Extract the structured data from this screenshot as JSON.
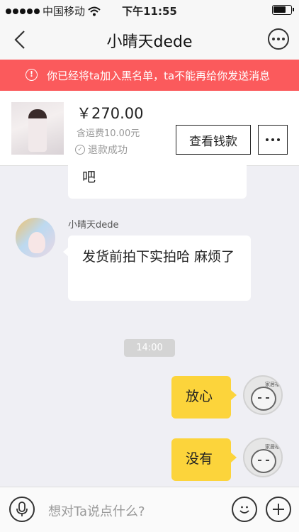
{
  "status_bar": {
    "carrier": "中国移动",
    "time": "下午11:55"
  },
  "nav": {
    "title": "小晴天dede"
  },
  "notice": {
    "text": "你已经将ta加入黑名单，ta不能再给你发送消息"
  },
  "order": {
    "price": "￥270.00",
    "shipping": "含运费10.00元",
    "refund_status": "退款成功",
    "view_button": "查看钱款"
  },
  "chat": {
    "partial_message": "吧",
    "sender_name": "小晴天dede",
    "message": "发货前拍下实拍哈 麻烦了",
    "time_label": "14:00",
    "my_messages": [
      "放心",
      "没有"
    ],
    "avatar_tag": "家居福"
  },
  "input_bar": {
    "placeholder": "想对Ta说点什么?"
  },
  "colors": {
    "notice_bg": "#fb5a5c",
    "my_bubble": "#fcd43b"
  }
}
